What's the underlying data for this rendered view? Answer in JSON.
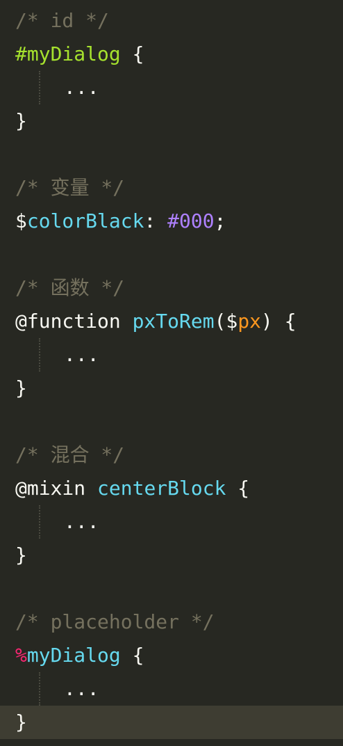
{
  "blocks": {
    "id": {
      "comment": "/* id */",
      "selector": "#myDialog",
      "open": " {",
      "body": "...",
      "close": "}"
    },
    "variable": {
      "comment": "/* 变量 */",
      "symbol": "$",
      "name": "colorBlack",
      "colon": ": ",
      "value": "#000",
      "semicolon": ";"
    },
    "function": {
      "comment": "/* 函数 */",
      "keyword": "@function",
      "space": " ",
      "name": "pxToRem",
      "paren_open": "(",
      "param_symbol": "$",
      "param": "px",
      "paren_close": ")",
      "open": " {",
      "body": "...",
      "close": "}"
    },
    "mixin": {
      "comment": "/* 混合 */",
      "keyword": "@mixin",
      "space": " ",
      "name": "centerBlock",
      "open": " {",
      "body": "...",
      "close": "}"
    },
    "placeholder": {
      "comment": "/* placeholder */",
      "symbol": "%",
      "name": "myDialog",
      "open": " {",
      "body": "...",
      "close": "}"
    }
  },
  "theme_colors": {
    "background": "#272822",
    "current_line": "#3e3d32",
    "comment": "#75715e",
    "id_selector": "#a6e22e",
    "placeholder_symbol": "#f92672",
    "variable": "#66d9ef",
    "number": "#ae81ff",
    "parameter": "#fd971f",
    "text": "#f8f8f2"
  }
}
